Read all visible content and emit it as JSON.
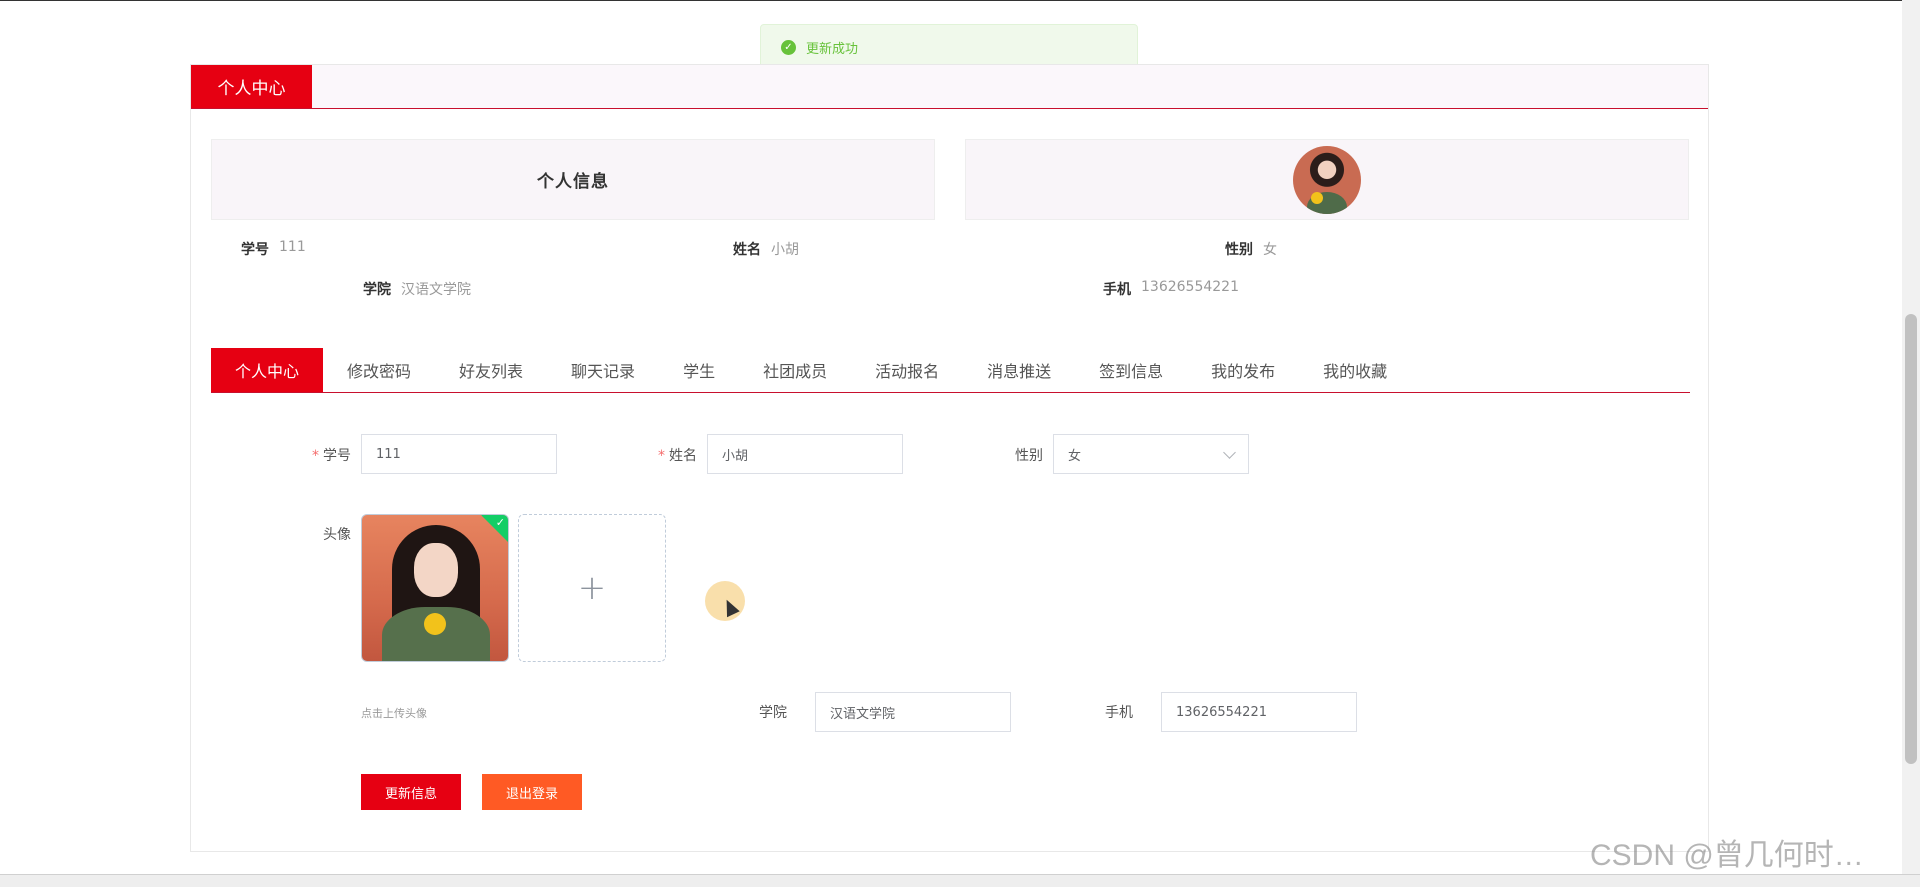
{
  "toast": {
    "message": "更新成功"
  },
  "panel": {
    "title": "个人中心"
  },
  "info": {
    "title": "个人信息",
    "fields": [
      {
        "key": "学号",
        "value": "111"
      },
      {
        "key": "姓名",
        "value": "小胡"
      },
      {
        "key": "性别",
        "value": "女"
      },
      {
        "key": "学院",
        "value": "汉语文学院"
      },
      {
        "key": "手机",
        "value": "13626554221"
      }
    ]
  },
  "tabs": [
    {
      "label": "个人中心",
      "active": true
    },
    {
      "label": "修改密码"
    },
    {
      "label": "好友列表"
    },
    {
      "label": "聊天记录"
    },
    {
      "label": "学生"
    },
    {
      "label": "社团成员"
    },
    {
      "label": "活动报名"
    },
    {
      "label": "消息推送"
    },
    {
      "label": "签到信息"
    },
    {
      "label": "我的发布"
    },
    {
      "label": "我的收藏"
    }
  ],
  "form": {
    "student_id": {
      "label": "学号",
      "value": "111",
      "required": true
    },
    "name": {
      "label": "姓名",
      "value": "小胡",
      "required": true
    },
    "gender": {
      "label": "性别",
      "value": "女"
    },
    "avatar": {
      "label": "头像",
      "hint": "点击上传头像"
    },
    "college": {
      "label": "学院",
      "value": "汉语文学院"
    },
    "phone": {
      "label": "手机",
      "value": "13626554221"
    }
  },
  "buttons": {
    "update": "更新信息",
    "logout": "退出登录"
  },
  "watermark": "CSDN @曾几何时…"
}
